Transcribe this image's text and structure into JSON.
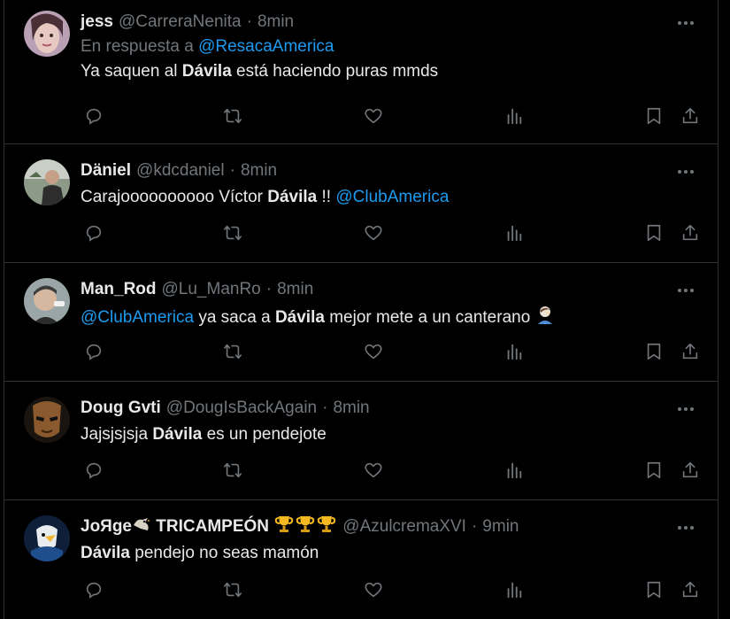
{
  "feed": {
    "tweets": [
      {
        "name": "jess",
        "handle": "@CarreraNenita",
        "time": "8min",
        "reply_prefix": "En respuesta a",
        "reply_to": "@ResacaAmerica",
        "text_before": "Ya saquen al ",
        "text_bold": "Dávila",
        "text_after": " está haciendo puras mmds"
      },
      {
        "name": "Däniel",
        "handle": "@kdcdaniel",
        "time": "8min",
        "text_before": "Carajoooooooooo Víctor ",
        "text_bold": "Dávila",
        "text_after": " !! ",
        "mention": "@ClubAmerica"
      },
      {
        "name": "Man_Rod",
        "handle": "@Lu_ManRo",
        "time": "8min",
        "mention": "@ClubAmerica",
        "text_before": " ya saca a ",
        "text_bold": "Dávila",
        "text_after": " mejor mete a un canterano ",
        "emoji": "facepalm-emoji"
      },
      {
        "name": "Doug Gvti",
        "handle": "@DougIsBackAgain",
        "time": "8min",
        "text_before": "Jajsjsjsja ",
        "text_bold": "Dávila",
        "text_after": " es un pendejote"
      },
      {
        "name_prefix": "JoЯge",
        "name_suffix": " TRICAMPEÓN ",
        "name_emojis": [
          "eagle-emoji",
          "trophy-emoji",
          "trophy-emoji",
          "trophy-emoji"
        ],
        "handle": "@AzulcremaXVI",
        "time": "9min",
        "text_bold": "Dávila",
        "text_after": " pendejo no seas mamón"
      }
    ],
    "dot": "·"
  },
  "icons": [
    "reply-icon",
    "retweet-icon",
    "like-icon",
    "views-icon",
    "bookmark-icon",
    "share-icon",
    "more-icon"
  ],
  "colors": {
    "background": "#000000",
    "text": "#e7e9ea",
    "muted": "#71767b",
    "link": "#1d9bf0",
    "divider": "#2f3336"
  }
}
